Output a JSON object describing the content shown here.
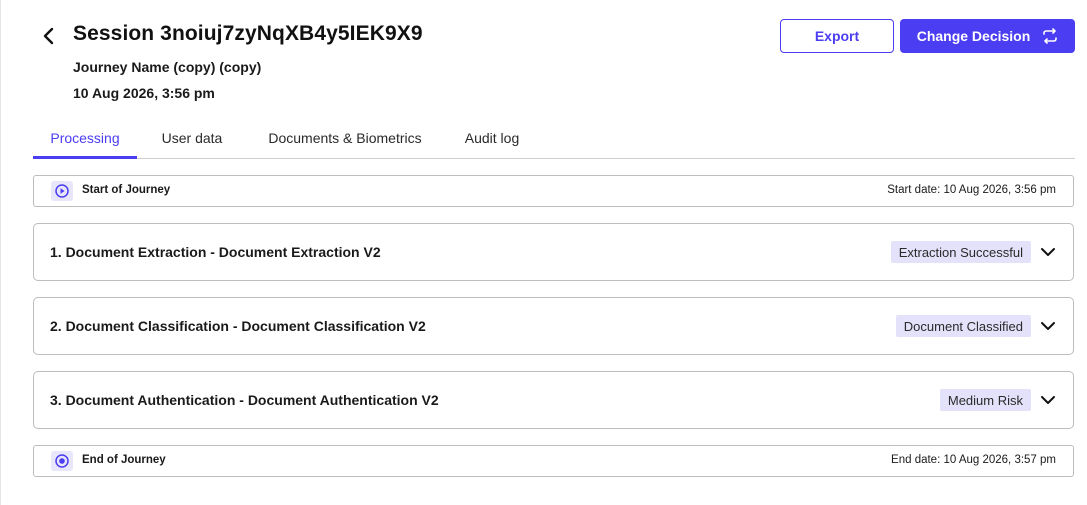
{
  "header": {
    "title": "Session 3noiuj7zyNqXB4y5IEK9X9",
    "journey_name": "Journey Name (copy) (copy)",
    "date": "10 Aug 2026, 3:56 pm",
    "export_label": "Export",
    "change_decision_label": "Change Decision"
  },
  "tabs": [
    {
      "label": "Processing",
      "active": true
    },
    {
      "label": "User data",
      "active": false
    },
    {
      "label": "Documents & Biometrics",
      "active": false
    },
    {
      "label": "Audit log",
      "active": false
    }
  ],
  "start": {
    "label": "Start of Journey",
    "date": "Start date: 10 Aug 2026, 3:56 pm",
    "icon": "play-circle-icon"
  },
  "steps": [
    {
      "title": "1. Document Extraction - Document Extraction V2",
      "badge": "Extraction Successful"
    },
    {
      "title": "2. Document Classification - Document Classification V2",
      "badge": "Document Classified"
    },
    {
      "title": "3. Document Authentication - Document Authentication V2",
      "badge": "Medium Risk"
    }
  ],
  "end": {
    "label": "End of Journey",
    "date": "End date: 10 Aug 2026, 3:57 pm",
    "icon": "stop-circle-icon"
  },
  "colors": {
    "accent": "#4b3df2",
    "badge_bg": "#e4e1fa",
    "icon_bg": "#e8e6fb",
    "border": "#bdbdbd"
  }
}
